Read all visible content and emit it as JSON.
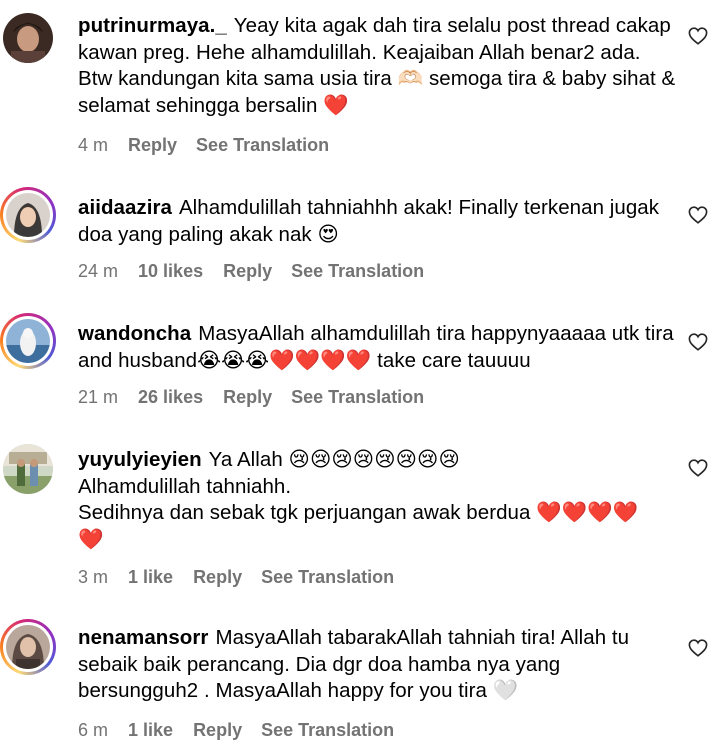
{
  "comments": [
    {
      "username": "putrinurmaya._",
      "text": "Yeay kita agak dah tira selalu post thread cakap kawan preg. Hehe alhamdulillah. Keajaiban Allah benar2 ada. Btw kandungan kita sama usia tira 🫶🏻 semoga tira & baby sihat & selamat sehingga bersalin ❤️",
      "time": "4 m",
      "likes": "",
      "reply_label": "Reply",
      "translate_label": "See Translation",
      "avatar": "avatar-photo"
    },
    {
      "username": "aiidaazira",
      "text": "Alhamdulillah tahniahhh akak! Finally terkenan jugak doa yang paling akak nak 😍",
      "time": "24 m",
      "likes": "10 likes",
      "reply_label": "Reply",
      "translate_label": "See Translation",
      "avatar": "avatar-photo"
    },
    {
      "username": "wandoncha",
      "text": "MasyaAllah alhamdulillah tira happynyaaaaa utk tira and husband😭😭😭❤️❤️❤️❤️ take care tauuuu",
      "time": "21 m",
      "likes": "26 likes",
      "reply_label": "Reply",
      "translate_label": "See Translation",
      "avatar": "avatar-photo"
    },
    {
      "username": "yuyulyieyien",
      "text": "Ya Allah 😢😢😢😢😢😢😢😢",
      "text2": "Alhamdulillah tahniahh.",
      "text3": "Sedihnya dan sebak tgk perjuangan awak berdua ❤️❤️❤️❤️",
      "text4": "❤️",
      "time": "3 m",
      "likes": "1 like",
      "reply_label": "Reply",
      "translate_label": "See Translation",
      "avatar": "avatar-photo"
    },
    {
      "username": "nenamansorr",
      "text": "MasyaAllah tabarakAllah tahniah tira! Allah tu sebaik baik perancang. Dia dgr doa hamba nya yang bersungguh2 . MasyaAllah happy for you tira 🤍",
      "time": "6 m",
      "likes": "1 like",
      "reply_label": "Reply",
      "translate_label": "See Translation",
      "avatar": "avatar-photo"
    }
  ],
  "icons": {
    "like": "heart-outline-icon"
  },
  "colors": {
    "meta_text": "#737373",
    "story_ring_start": "#feda75",
    "story_ring_end": "#962fbf"
  }
}
